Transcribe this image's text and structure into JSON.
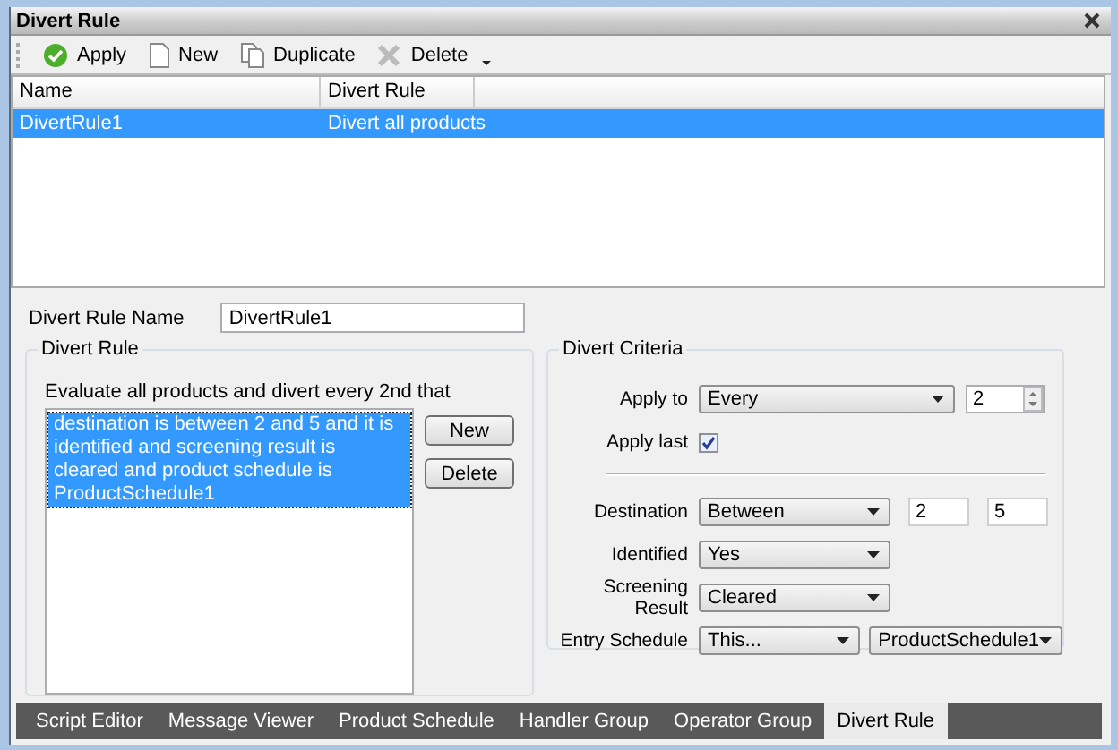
{
  "panel": {
    "title": "Divert Rule"
  },
  "toolbar": [
    {
      "label": "Apply",
      "kind": "apply"
    },
    {
      "label": "New",
      "kind": "new"
    },
    {
      "label": "Duplicate",
      "kind": "duplicate"
    },
    {
      "label": "Delete",
      "kind": "delete"
    }
  ],
  "table": {
    "columns": [
      "Name",
      "Divert Rule"
    ],
    "rows": [
      {
        "cells": [
          "DivertRule1",
          "Divert all products"
        ],
        "selected": true
      }
    ]
  },
  "name_field": {
    "label": "Divert Rule Name",
    "value": "DivertRule1"
  },
  "divert_rule": {
    "title": "Divert Rule",
    "intro": "Evaluate all products and divert every 2nd that",
    "items": [
      {
        "text": "destination is between 2 and 5 and it is identified and screening result is cleared and product schedule is ProductSchedule1",
        "selected": true
      }
    ],
    "buttons": [
      "New",
      "Delete"
    ]
  },
  "criteria": {
    "title": "Divert Criteria",
    "apply_rows": [
      {
        "kind": "combo_spin",
        "label": "Apply to",
        "value": "Every",
        "number": "2"
      },
      {
        "kind": "checkbox",
        "label": "Apply last",
        "checked": true
      }
    ],
    "condition_rows": [
      {
        "kind": "range",
        "label": "Destination",
        "value": "Between",
        "from": "2",
        "to": "5"
      },
      {
        "kind": "select",
        "label": "Identified",
        "value": "Yes"
      },
      {
        "kind": "select",
        "label": "Screening Result",
        "value": "Cleared"
      },
      {
        "kind": "double_select",
        "label": "Entry Schedule",
        "value": "This...",
        "second": "ProductSchedule1"
      }
    ]
  },
  "tabs": [
    {
      "label": "Script Editor",
      "selected": false
    },
    {
      "label": "Message Viewer",
      "selected": false
    },
    {
      "label": "Product Schedule",
      "selected": false
    },
    {
      "label": "Handler Group",
      "selected": false
    },
    {
      "label": "Operator Group",
      "selected": false
    },
    {
      "label": "Divert Rule",
      "selected": true
    }
  ]
}
